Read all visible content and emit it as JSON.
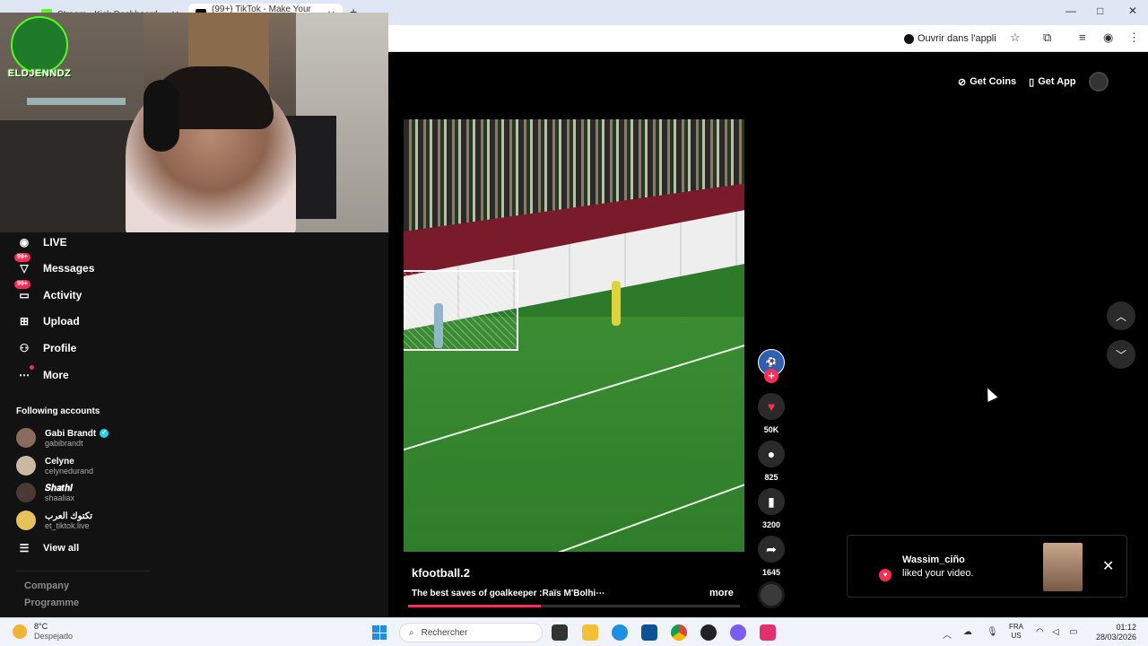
{
  "browser": {
    "tabs": [
      {
        "label": "Stream - Kick Dashboard"
      },
      {
        "label": "(99+) TikTok - Make Your D..."
      }
    ],
    "new_tab": "+",
    "open_app_label": "Ouvrir dans l'appli",
    "window_controls": {
      "minimize": "—",
      "maximize": "□",
      "close": "✕"
    }
  },
  "webcam": {
    "logo_text": "ELDJENNDZ"
  },
  "sidebar": {
    "nav": [
      {
        "label": "LIVE",
        "icon": "live-icon",
        "badge": ""
      },
      {
        "label": "Messages",
        "icon": "messages-icon",
        "badge": "99+"
      },
      {
        "label": "Activity",
        "icon": "activity-icon",
        "badge": "99+"
      },
      {
        "label": "Upload",
        "icon": "upload-icon",
        "badge": ""
      },
      {
        "label": "Profile",
        "icon": "profile-icon",
        "badge": ""
      },
      {
        "label": "More",
        "icon": "more-icon",
        "badge": ""
      }
    ],
    "following_title": "Following accounts",
    "accounts": [
      {
        "name": "Gabi Brandt",
        "handle": "gabibrandt",
        "verified": true
      },
      {
        "name": "Celyne",
        "handle": "celynedurand",
        "verified": false
      },
      {
        "name": "𝑺𝒉𝒂𝒕𝒉𝒊",
        "handle": "shaaliax",
        "verified": false
      },
      {
        "name": "تكتوك العرب",
        "handle": "et_tiktok.live",
        "verified": false
      }
    ],
    "view_all": "View all",
    "footer": [
      "Company",
      "Programme"
    ]
  },
  "header": {
    "get_coins": "Get Coins",
    "get_app": "Get App"
  },
  "video": {
    "username": "kfootball.2",
    "caption": "The best saves of goalkeeper :Raïs M'Bolhi⋯",
    "more": "more",
    "progress": 0.4
  },
  "rail": {
    "follow": "+",
    "likes": "50K",
    "comments": "825",
    "saves": "3200",
    "shares": "1645"
  },
  "notification": {
    "name": "Wassim_ciño",
    "message": "liked your video.",
    "close": "✕"
  },
  "taskbar": {
    "temperature": "8°C",
    "condition": "Despejado",
    "search_placeholder": "Rechercher",
    "lang_top": "FRA",
    "lang_bottom": "US",
    "time": "01:12",
    "date": "28/03/2026"
  },
  "colors": {
    "accent": "#fe2c55",
    "kick_green": "#53fc18",
    "verified": "#20d5ec"
  }
}
